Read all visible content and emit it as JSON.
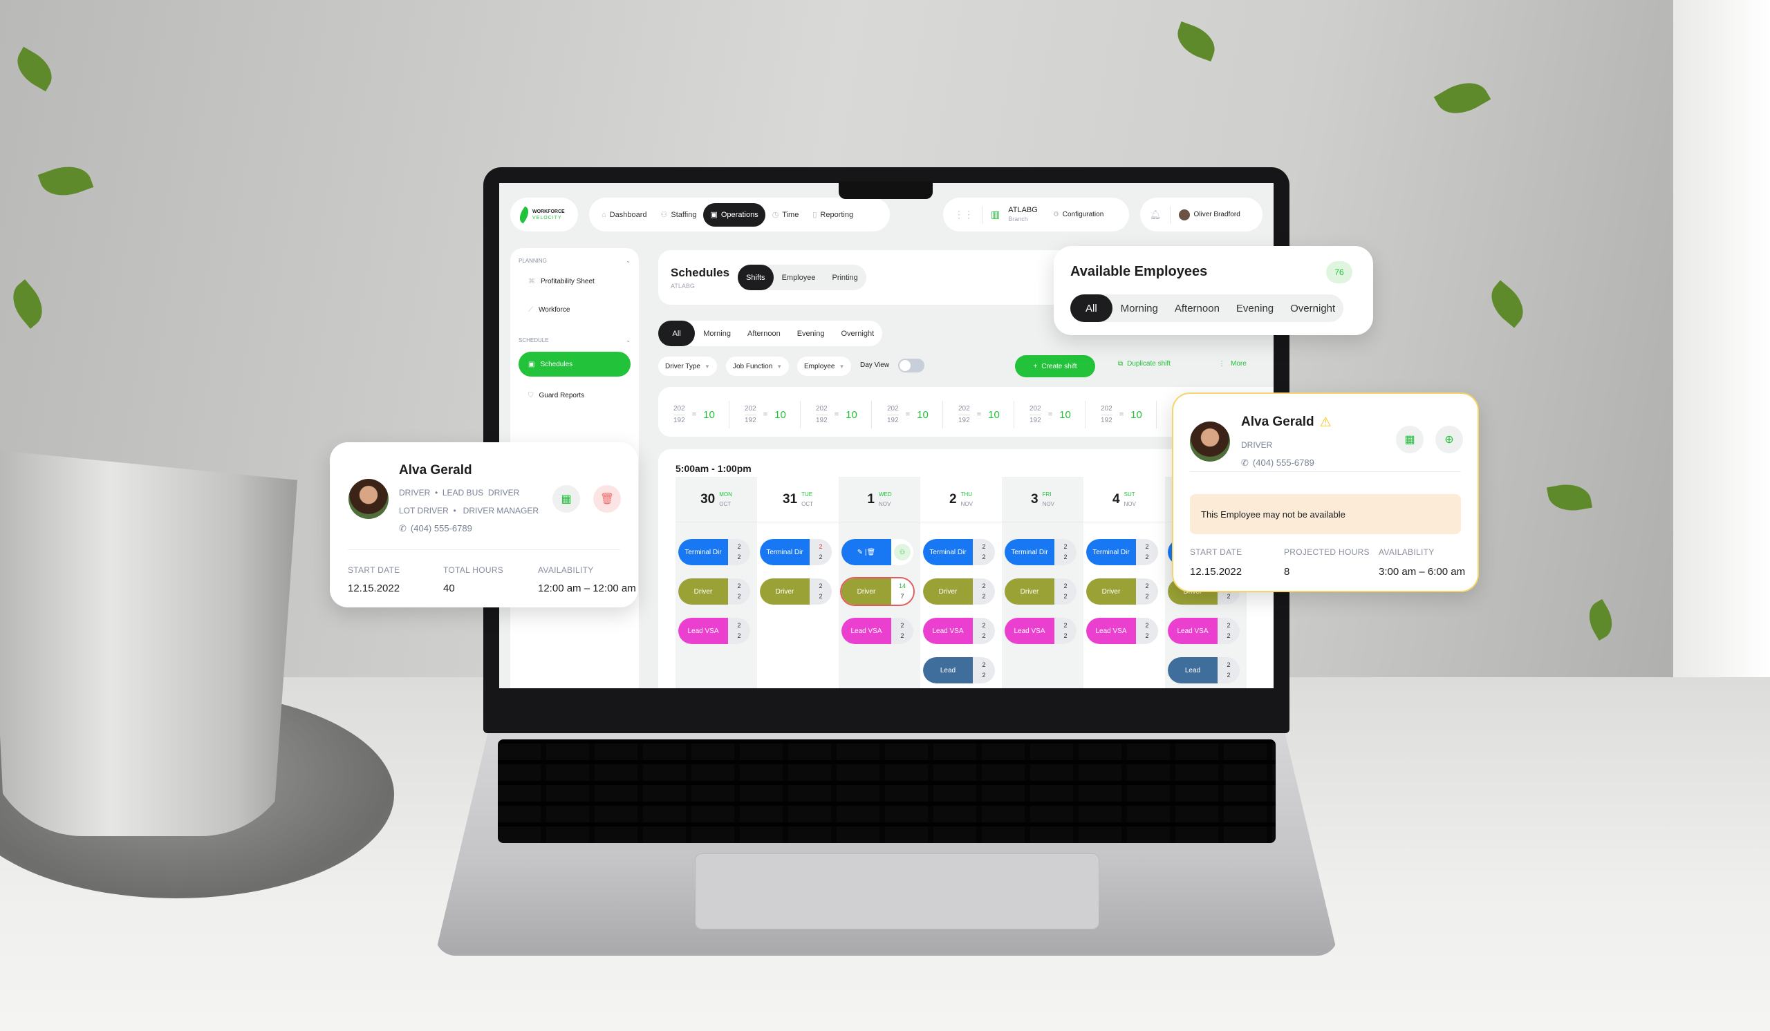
{
  "nav": {
    "logo_top": "WORKFORCE",
    "logo_bottom": "VELOCITY",
    "items": [
      {
        "label": "Dashboard",
        "icon": "home-icon"
      },
      {
        "label": "Staffing",
        "icon": "people-icon"
      },
      {
        "label": "Operations",
        "icon": "calendar-icon",
        "active": true
      },
      {
        "label": "Time",
        "icon": "clock-icon"
      },
      {
        "label": "Reporting",
        "icon": "document-icon"
      }
    ],
    "branch_name": "ATLABG",
    "branch_label": "Branch",
    "configuration": "Configuration",
    "user_name": "Oliver Bradford"
  },
  "sidebar": {
    "planning_header": "PLANNING",
    "planning_items": [
      "Profitability Sheet",
      "Workforce"
    ],
    "schedule_header": "SCHEDULE",
    "schedule_items": [
      {
        "label": "Schedules",
        "active": true
      },
      {
        "label": "Guard Reports"
      }
    ]
  },
  "schedules": {
    "title": "Schedules",
    "subtitle": "ATLABG",
    "tabs": [
      "Shifts",
      "Employee",
      "Printing"
    ],
    "active_tab": "Shifts"
  },
  "shift_filter": {
    "options": [
      "All",
      "Morning",
      "Afternoon",
      "Evening",
      "Overnight"
    ],
    "selected": "All"
  },
  "toolbar": {
    "driver_type": "Driver Type",
    "job_function": "Job Function",
    "employee": "Employee",
    "day_view": "Day View",
    "day_view_on": false,
    "create_shift": "Create shift",
    "duplicate_shift": "Duplicate shift",
    "more": "More"
  },
  "stats": [
    {
      "top": "202",
      "bottom": "192",
      "result": "10"
    },
    {
      "top": "202",
      "bottom": "192",
      "result": "10"
    },
    {
      "top": "202",
      "bottom": "192",
      "result": "10"
    },
    {
      "top": "202",
      "bottom": "192",
      "result": "10"
    },
    {
      "top": "202",
      "bottom": "192",
      "result": "10"
    },
    {
      "top": "202",
      "bottom": "192",
      "result": "10"
    },
    {
      "top": "202",
      "bottom": "192",
      "result": "10"
    }
  ],
  "calendar": {
    "time_range": "5:00am - 1:00pm",
    "colors": {
      "Terminal Dir": "#1877f2",
      "Driver": "#9aa236",
      "Lead VSA": "#ea3fcf",
      "Lead": "#3f6e9c",
      "accent": "#22c23a"
    },
    "days": [
      {
        "num": "30",
        "dow": "MON",
        "month": "OCT",
        "shifts": [
          {
            "label": "Terminal Dir",
            "a": "2",
            "b": "2"
          },
          {
            "label": "Driver",
            "a": "2",
            "b": "2"
          },
          {
            "label": "Lead VSA",
            "a": "2",
            "b": "2"
          }
        ]
      },
      {
        "num": "31",
        "dow": "TUE",
        "month": "OCT",
        "shifts": [
          {
            "label": "Terminal Dir",
            "a": "2",
            "b": "2",
            "alert": true
          },
          {
            "label": "Driver",
            "a": "2",
            "b": "2"
          }
        ]
      },
      {
        "num": "1",
        "dow": "WED",
        "month": "NOV",
        "shifts": [
          {
            "label": "Terminal Dir",
            "editing": true
          },
          {
            "label": "Driver",
            "a": "14",
            "b": "7",
            "selected": true
          },
          {
            "label": "Lead VSA",
            "a": "2",
            "b": "2"
          }
        ]
      },
      {
        "num": "2",
        "dow": "THU",
        "month": "NOV",
        "shifts": [
          {
            "label": "Terminal Dir",
            "a": "2",
            "b": "2"
          },
          {
            "label": "Driver",
            "a": "2",
            "b": "2"
          },
          {
            "label": "Lead VSA",
            "a": "2",
            "b": "2"
          },
          {
            "label": "Lead",
            "a": "2",
            "b": "2"
          }
        ]
      },
      {
        "num": "3",
        "dow": "FRI",
        "month": "NOV",
        "shifts": [
          {
            "label": "Terminal Dir",
            "a": "2",
            "b": "2"
          },
          {
            "label": "Driver",
            "a": "2",
            "b": "2"
          },
          {
            "label": "Lead VSA",
            "a": "2",
            "b": "2"
          }
        ]
      },
      {
        "num": "4",
        "dow": "SUT",
        "month": "NOV",
        "shifts": [
          {
            "label": "Terminal Dir",
            "a": "2",
            "b": "2"
          },
          {
            "label": "Driver",
            "a": "2",
            "b": "2"
          },
          {
            "label": "Lead VSA",
            "a": "2",
            "b": "2"
          }
        ]
      },
      {
        "num": "",
        "dow": "",
        "month": "",
        "shifts": [
          {
            "label": "Terminal Dir",
            "a": "2",
            "b": "2"
          },
          {
            "label": "Driver",
            "a": "2",
            "b": "2"
          },
          {
            "label": "Lead VSA",
            "a": "2",
            "b": "2"
          },
          {
            "label": "Lead",
            "a": "2",
            "b": "2"
          }
        ]
      }
    ]
  },
  "available_employees": {
    "title": "Available Employees",
    "count": "76",
    "filters": [
      "All",
      "Morning",
      "Afternoon",
      "Evening",
      "Overnight"
    ],
    "selected": "All"
  },
  "employee_card": {
    "name": "Alva Gerald",
    "roles_line1": "DRIVER  •  LEAD BUS  DRIVER",
    "roles_line2": "LOT DRIVER  •   DRIVER MANAGER",
    "phone": "(404) 555-6789",
    "start_date_label": "START DATE",
    "start_date": "12.15.2022",
    "hours_label": "TOTAL HOURS",
    "hours": "40",
    "availability_label": "AVAILABILITY",
    "availability": "12:00 am – 12:00 am"
  },
  "warning_card": {
    "name": "Alva Gerald",
    "role": "DRIVER",
    "phone": "(404) 555-6789",
    "warning": "This Employee may not be available",
    "start_date_label": "START DATE",
    "start_date": "12.15.2022",
    "hours_label": "PROJECTED HOURS",
    "hours": "8",
    "availability_label": "AVAILABILITY",
    "availability": "3:00 am – 6:00 am"
  }
}
